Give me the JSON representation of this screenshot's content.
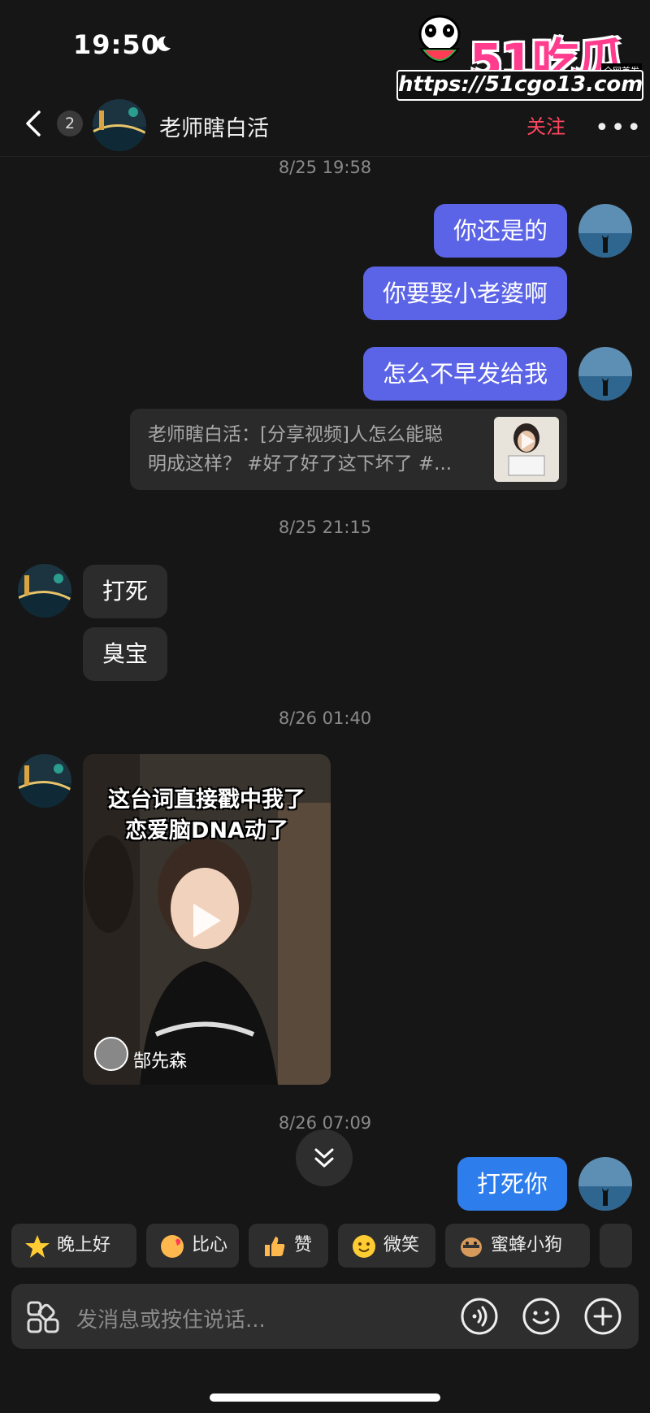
{
  "status": {
    "time": "19:50"
  },
  "watermark": {
    "logo": "51吃瓜",
    "tag": "全网首发",
    "url": "https://51cgo13.com"
  },
  "header": {
    "unread_count": "2",
    "title": "老师瞎白活",
    "follow_label": "关注",
    "more_label": "•••"
  },
  "timestamps": [
    "8/25 19:58",
    "8/25 21:15",
    "8/26 01:40",
    "8/26 07:09"
  ],
  "messages": {
    "m1": "你还是的",
    "m2": "你要娶小老婆啊",
    "m3": "怎么不早发给我",
    "share_line1": "老师瞎白活：[分享视频]人怎么能聪",
    "share_line2": "明成这样？ #好了好了这下坏了 #...",
    "o1": "打死",
    "o2": "臭宝",
    "video_caption1": "这台词直接戳中我了",
    "video_caption2": "恋爱脑DNA动了",
    "video_author": "郜先森",
    "m4": "打死你"
  },
  "quick_replies": [
    {
      "label": "晚上好",
      "icon": "star-emoji"
    },
    {
      "label": "比心",
      "icon": "heart-hand-emoji"
    },
    {
      "label": "赞",
      "icon": "thumbs-up-emoji"
    },
    {
      "label": "微笑",
      "icon": "smile-emoji"
    },
    {
      "label": "蜜蜂小狗",
      "icon": "bee-dog-emoji"
    }
  ],
  "input": {
    "placeholder": "发消息或按住说话..."
  },
  "colors": {
    "my_bubble": "#5b63e7",
    "last_bubble": "#2d7dec",
    "follow": "#ff4660",
    "background": "#161616"
  }
}
